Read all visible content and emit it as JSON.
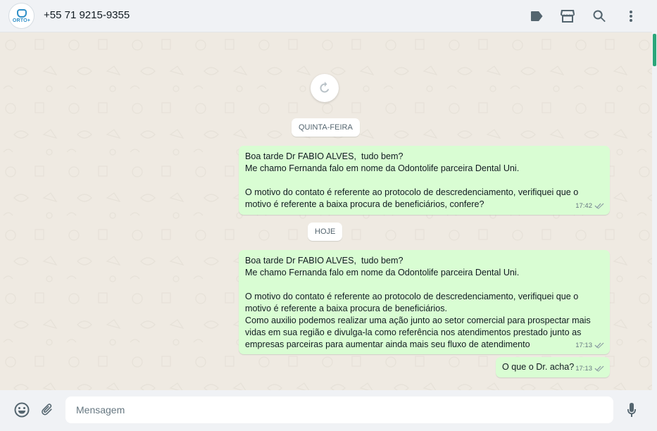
{
  "header": {
    "avatar_label": "ORTO+",
    "contact_name": "+55 71 9215-9355"
  },
  "chat": {
    "date_chips": [
      "QUINTA-FEIRA",
      "HOJE"
    ],
    "messages": [
      {
        "text": "Boa tarde Dr FABIO ALVES,  tudo bem?\nMe chamo Fernanda falo em nome da Odontolife parceira Dental Uni.\n\nO motivo do contato é referente ao protocolo de descredenciamento, verifiquei que o\nmotivo é referente a baixa procura de beneficiários, confere?",
        "time": "17:42"
      },
      {
        "text": "Boa tarde Dr FABIO ALVES,  tudo bem?\nMe chamo Fernanda falo em nome da Odontolife parceira Dental Uni.\n\nO motivo do contato é referente ao protocolo de descredenciamento, verifiquei que o\nmotivo é referente a baixa procura de beneficiários.\nComo auxilio podemos realizar uma ação junto ao setor comercial para prospectar mais\nvidas em sua região e divulga-la como referência nos atendimentos prestado junto as\nempresas parceiras para aumentar ainda mais seu fluxo de atendimento",
        "time": "17:13"
      },
      {
        "text": "O que o Dr. acha?",
        "time": "17:13"
      }
    ]
  },
  "composer": {
    "placeholder": "Mensagem"
  },
  "colors": {
    "outgoing_bubble": "#d9fdd3",
    "chat_background": "#efeae2",
    "accent": "#00a884"
  }
}
